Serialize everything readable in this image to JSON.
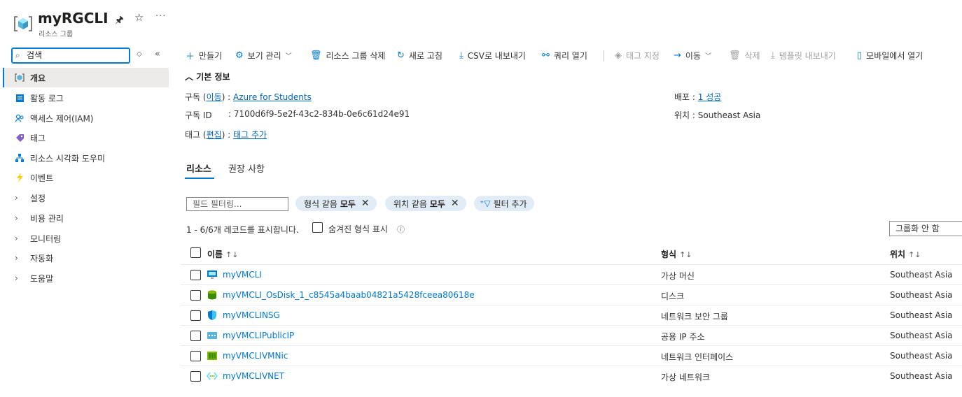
{
  "header": {
    "title": "myRGCLI",
    "subtitle": "리소스 그룹",
    "more": "···"
  },
  "nav": {
    "search_value": "검색",
    "items": [
      {
        "label": "개요",
        "icon": "overview-icon",
        "active": true
      },
      {
        "label": "활동 로그",
        "icon": "activity-log-icon"
      },
      {
        "label": "액세스 제어(IAM)",
        "icon": "iam-icon"
      },
      {
        "label": "태그",
        "icon": "tag-icon"
      },
      {
        "label": "리소스 시각화 도우미",
        "icon": "visualizer-icon"
      },
      {
        "label": "이벤트",
        "icon": "events-icon"
      },
      {
        "label": "설정",
        "icon": "chevron-right-icon"
      },
      {
        "label": "비용 관리",
        "icon": "chevron-right-icon"
      },
      {
        "label": "모니터링",
        "icon": "chevron-right-icon"
      },
      {
        "label": "자동화",
        "icon": "chevron-right-icon"
      },
      {
        "label": "도움말",
        "icon": "chevron-right-icon"
      }
    ]
  },
  "toolbar": {
    "create": "만들기",
    "view_manage": "보기 관리",
    "delete_rg": "리소스 그룹 삭제",
    "refresh": "새로 고침",
    "export_csv": "CSV로 내보내기",
    "open_query": "쿼리 열기",
    "assign_tags": "태그 지정",
    "move": "이동",
    "delete": "삭제",
    "export_template": "템플릿 내보내기",
    "open_mobile": "모바일에서 열기"
  },
  "essentials": {
    "toggle_label": "기본 정보",
    "subscription_label": "구독",
    "subscription_move": "이동",
    "subscription_value": "Azure for Students",
    "subscription_id_label": "구독 ID",
    "subscription_id_value": "7100d6f9-5e2f-43c2-834b-0e6c61d24e91",
    "tags_label": "태그",
    "tags_edit": "편집",
    "tags_add": "태그 추가",
    "deployments_label": "배포",
    "deployments_value": "1 성공",
    "location_label": "위치",
    "location_value": "Southeast Asia"
  },
  "tabs": {
    "resources": "리소스",
    "recommendations": "권장 사항"
  },
  "filters": {
    "placeholder": "필드 필터링...",
    "type_prefix": "형식 같음",
    "type_value": "모두",
    "location_prefix": "위치 같음",
    "location_value": "모두",
    "add_filter": "필터 추가"
  },
  "records": {
    "count_text": "1 - 6/6개 레코드를 표시합니다.",
    "show_hidden": "숨겨진 형식 표시",
    "grouping": "그룹화 안 함"
  },
  "table": {
    "headers": {
      "name": "이름",
      "type": "형식",
      "location": "위치"
    },
    "rows": [
      {
        "name": "myVMCLI",
        "type": "가상 머신",
        "location": "Southeast Asia",
        "icon": "virtual-machine-icon"
      },
      {
        "name": "myVMCLI_OsDisk_1_c8545a4baab04821a5428fceea80618e",
        "type": "디스크",
        "location": "Southeast Asia",
        "icon": "disk-icon"
      },
      {
        "name": "myVMCLINSG",
        "type": "네트워크 보안 그룹",
        "location": "Southeast Asia",
        "icon": "nsg-icon"
      },
      {
        "name": "myVMCLIPublicIP",
        "type": "공용 IP 주소",
        "location": "Southeast Asia",
        "icon": "public-ip-icon"
      },
      {
        "name": "myVMCLIVMNic",
        "type": "네트워크 인터페이스",
        "location": "Southeast Asia",
        "icon": "nic-icon"
      },
      {
        "name": "myVMCLIVNET",
        "type": "가상 네트워크",
        "location": "Southeast Asia",
        "icon": "vnet-icon"
      }
    ]
  }
}
